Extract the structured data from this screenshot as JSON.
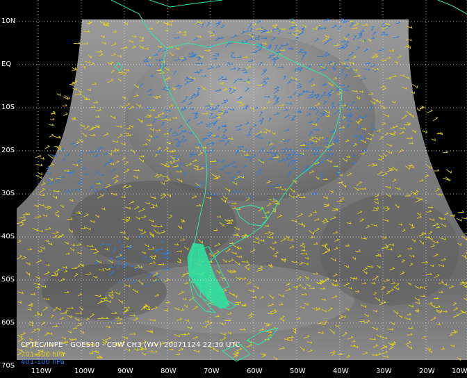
{
  "caption": "CPTEC/INPE - GOES10 - CDW CH3 (WV) 20071124 22:30 UTC",
  "legend": [
    {
      "label": "701-400 hPa",
      "color": "#e2d21a"
    },
    {
      "label": "401-100 hPa",
      "color": "#2f7ad6"
    }
  ],
  "lat_labels": [
    "10N",
    "EQ",
    "10S",
    "20S",
    "30S",
    "40S",
    "50S",
    "60S",
    "70S"
  ],
  "lon_labels": [
    "110W",
    "100W",
    "90W",
    "80W",
    "70W",
    "60W",
    "50W",
    "40W",
    "30W",
    "20W",
    "10W"
  ],
  "colors": {
    "coastline": "#2ee6a2",
    "grid": "#ffffff",
    "background": "#000000",
    "imagery_dark": "#4a4a4a",
    "imagery_light": "#b8b8b8"
  }
}
